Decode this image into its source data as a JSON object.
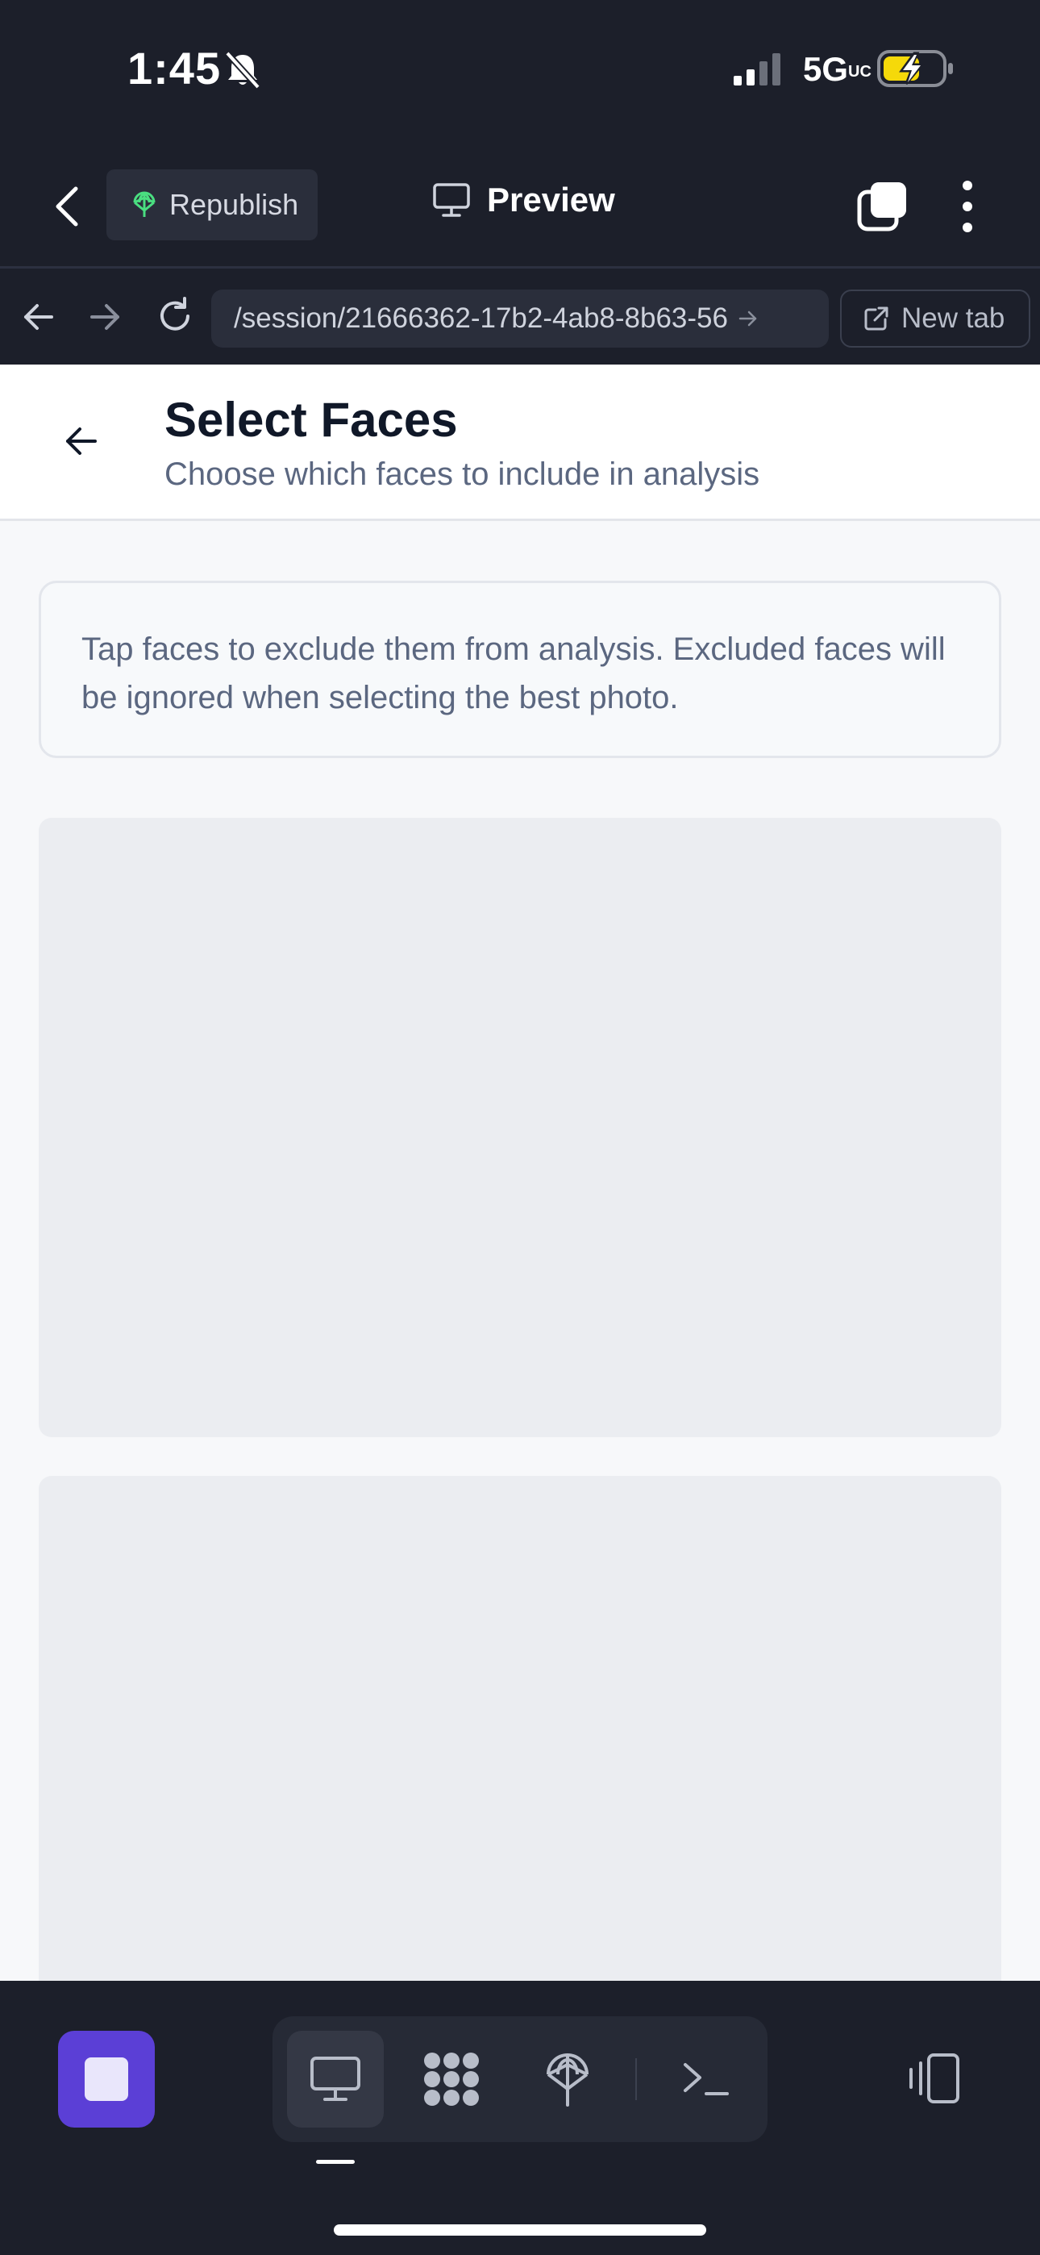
{
  "status_bar": {
    "time": "1:45",
    "network": "5G",
    "network_suffix": "UC",
    "bell_icon": "bell-slash-icon",
    "battery_icon": "battery-charging-icon"
  },
  "toolbar": {
    "republish_label": "Republish",
    "preview_label": "Preview"
  },
  "browser": {
    "url": "/session/21666362-17b2-4ab8-8b63-56",
    "new_tab_label": "New tab"
  },
  "page": {
    "title": "Select Faces",
    "subtitle": "Choose which faces to include in analysis",
    "info_text": "Tap faces to exclude them from analysis. Excluded faces will be ignored when selecting the best photo."
  },
  "dock": {
    "tabs": [
      "preview",
      "agent",
      "deploy",
      "shell"
    ],
    "active_tab": "preview"
  },
  "colors": {
    "chrome_bg": "#1c1f2a",
    "accent_purple": "#5b3fd6",
    "republish_icon": "#4ade80",
    "battery_fill": "#f5d90a",
    "placeholder": "#ebedf1"
  }
}
